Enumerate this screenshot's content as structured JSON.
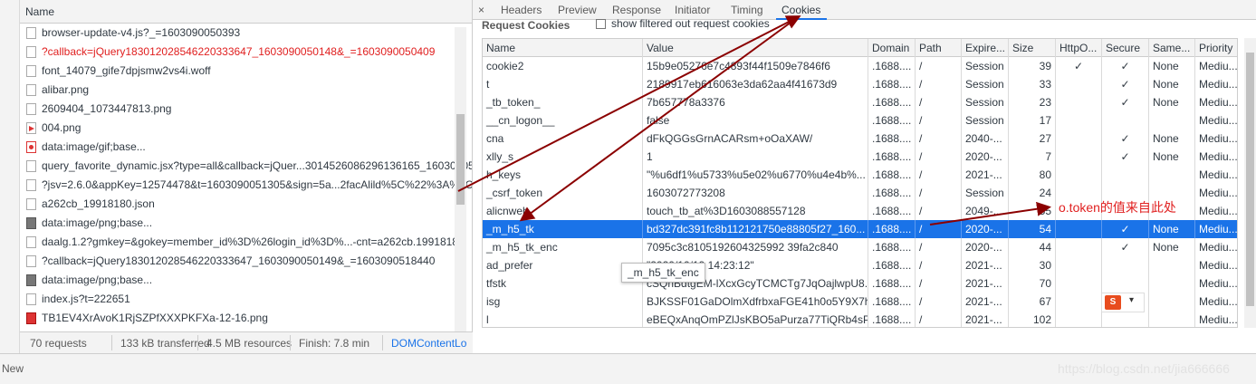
{
  "network": {
    "name_header": "Name",
    "requests": [
      {
        "name": "browser-update-v4.js?_=1603090050393",
        "icon": "document-icon",
        "error": false
      },
      {
        "name": "?callback=jQuery18301202854622033364​7_1603090050148&_=1603090050409",
        "icon": "document-icon",
        "error": true
      },
      {
        "name": "font_14079_gife7dpjsmw2vs4i.woff",
        "icon": "document-icon",
        "error": false
      },
      {
        "name": "alibar.png",
        "icon": "document-icon",
        "error": false
      },
      {
        "name": "2609404_1073447813.png",
        "icon": "document-icon",
        "error": false
      },
      {
        "name": "004.png",
        "icon": "red-image-icon",
        "error": false
      },
      {
        "name": "data:image/gif;base...",
        "icon": "gif-image-icon",
        "error": false
      },
      {
        "name": "query_favorite_dynamic.jsx?type=all&callback=jQuer...3014526086296136165_16030905",
        "icon": "document-icon",
        "error": false
      },
      {
        "name": "?jsv=2.6.0&appKey=12574478&t=1603090051305&sign=5a...2facAlild%5C%22%3A%5C",
        "icon": "document-icon",
        "error": false
      },
      {
        "name": "a262cb_19918180.json",
        "icon": "document-icon",
        "error": false
      },
      {
        "name": "data:image/png;base...",
        "icon": "image-icon",
        "error": false
      },
      {
        "name": "daalg.1.2?gmkey=&gokey=member_id%3D%26login_id%3D%...-cnt=a262cb.19918180",
        "icon": "document-icon",
        "error": false
      },
      {
        "name": "?callback=jQuery183012028546220333647_1603090050149&_=1603090518440",
        "icon": "document-icon",
        "error": false
      },
      {
        "name": "data:image/png;base...",
        "icon": "image-icon",
        "error": false
      },
      {
        "name": "index.js?t=222651",
        "icon": "document-icon",
        "error": false
      },
      {
        "name": "TB1EV4XrAvoK1RjSZPfXXXPKFXa-12-16.png",
        "icon": "red-image-icon",
        "error": false
      }
    ],
    "status": {
      "requests": "70 requests",
      "transferred": "133 kB transferred",
      "resources": "4.5 MB resources",
      "finish": "Finish: 7.8 min",
      "domcontentloaded": "DOMContentLo"
    }
  },
  "detail": {
    "close": "×",
    "tabs": [
      "Headers",
      "Preview",
      "Response",
      "Initiator",
      "Timing",
      "Cookies"
    ],
    "active_tab": "Cookies",
    "section_title": "Request Cookies",
    "filter_label": "show filtered out request cookies",
    "columns": [
      "Name",
      "Value",
      "Domain",
      "Path",
      "Expire...",
      "Size",
      "HttpO...",
      "Secure",
      "Same...",
      "Priority"
    ],
    "rows": [
      {
        "name": "cookie2",
        "value": "15b9e05276e7c4893f44f1509e7846f6",
        "domain": ".1688....",
        "path": "/",
        "expires": "Session",
        "size": "39",
        "httponly": "✓",
        "secure": "✓",
        "samesite": "None",
        "priority": "Mediu..."
      },
      {
        "name": "t",
        "value": "2189917eb616063e3da62aa4f41673d9",
        "domain": ".1688....",
        "path": "/",
        "expires": "Session",
        "size": "33",
        "httponly": "",
        "secure": "✓",
        "samesite": "None",
        "priority": "Mediu..."
      },
      {
        "name": "_tb_token_",
        "value": "7b657778a3376",
        "domain": ".1688....",
        "path": "/",
        "expires": "Session",
        "size": "23",
        "httponly": "",
        "secure": "✓",
        "samesite": "None",
        "priority": "Mediu..."
      },
      {
        "name": "__cn_logon__",
        "value": "false",
        "domain": ".1688....",
        "path": "/",
        "expires": "Session",
        "size": "17",
        "httponly": "",
        "secure": "",
        "samesite": "",
        "priority": "Mediu..."
      },
      {
        "name": "cna",
        "value": "dFkQGGsGrnACARsm+oOaXAW/",
        "domain": ".1688....",
        "path": "/",
        "expires": "2040-...",
        "size": "27",
        "httponly": "",
        "secure": "✓",
        "samesite": "None",
        "priority": "Mediu..."
      },
      {
        "name": "xlly_s",
        "value": "1",
        "domain": ".1688....",
        "path": "/",
        "expires": "2020-...",
        "size": "7",
        "httponly": "",
        "secure": "✓",
        "samesite": "None",
        "priority": "Mediu..."
      },
      {
        "name": "h_keys",
        "value": "\"%u6df1%u5733%u5e02%u6770%u4e4b%...",
        "domain": ".1688....",
        "path": "/",
        "expires": "2021-...",
        "size": "80",
        "httponly": "",
        "secure": "",
        "samesite": "",
        "priority": "Mediu..."
      },
      {
        "name": "_csrf_token",
        "value": "1603072773208",
        "domain": ".1688....",
        "path": "/",
        "expires": "Session",
        "size": "24",
        "httponly": "",
        "secure": "",
        "samesite": "",
        "priority": "Mediu..."
      },
      {
        "name": "alicnweb",
        "value": "touch_tb_at%3D1603088557128",
        "domain": ".1688....",
        "path": "/",
        "expires": "2049-...",
        "size": "55",
        "httponly": "",
        "secure": "",
        "samesite": "",
        "priority": "Mediu..."
      },
      {
        "name": "_m_h5_tk",
        "value": "bd327dc391fc8b112121750e88805f27_160...",
        "domain": ".1688....",
        "path": "/",
        "expires": "2020-...",
        "size": "54",
        "httponly": "",
        "secure": "✓",
        "samesite": "None",
        "priority": "Mediu..."
      },
      {
        "name": "_m_h5_tk_enc",
        "value": "7095c3c8105192604325992 39fa2c840",
        "domain": ".1688....",
        "path": "/",
        "expires": "2020-...",
        "size": "44",
        "httponly": "",
        "secure": "✓",
        "samesite": "None",
        "priority": "Mediu..."
      },
      {
        "name": "ad_prefer",
        "value": "\"2020/10/19 14:23:12\"",
        "domain": ".1688....",
        "path": "/",
        "expires": "2021-...",
        "size": "30",
        "httponly": "",
        "secure": "",
        "samesite": "",
        "priority": "Mediu..."
      },
      {
        "name": "tfstk",
        "value": "cSQhBdtgEM-lXcxGcyTCMCTg7JqOajlwpU8...",
        "domain": ".1688....",
        "path": "/",
        "expires": "2021-...",
        "size": "70",
        "httponly": "",
        "secure": "",
        "samesite": "",
        "priority": "Mediu..."
      },
      {
        "name": "isg",
        "value": "BJKSSF01GaDOlmXdfrbxaFGE41h0o5Y9X7h...",
        "domain": ".1688....",
        "path": "/",
        "expires": "2021-...",
        "size": "67",
        "httponly": "",
        "secure": "",
        "samesite": "",
        "priority": "Mediu..."
      },
      {
        "name": "l",
        "value": "eBEQxAnqOmPZlJsKBO5aPurza77TiQRb4sP...",
        "domain": ".1688....",
        "path": "/",
        "expires": "2021-...",
        "size": "102",
        "httponly": "",
        "secure": "",
        "samesite": "",
        "priority": "Mediu..."
      }
    ],
    "selected_row": 9,
    "tooltip": "_m_h5_tk_enc"
  },
  "bottom": {
    "label": "New"
  },
  "annotation": "o.token的值来自此处",
  "watermark": "https://blog.csdn.net/jia666666",
  "widget": {
    "logo": "S",
    "caret": "▾"
  },
  "colors": {
    "accent": "#1a73e8",
    "error": "#e02020",
    "arrow": "#8b0000"
  }
}
